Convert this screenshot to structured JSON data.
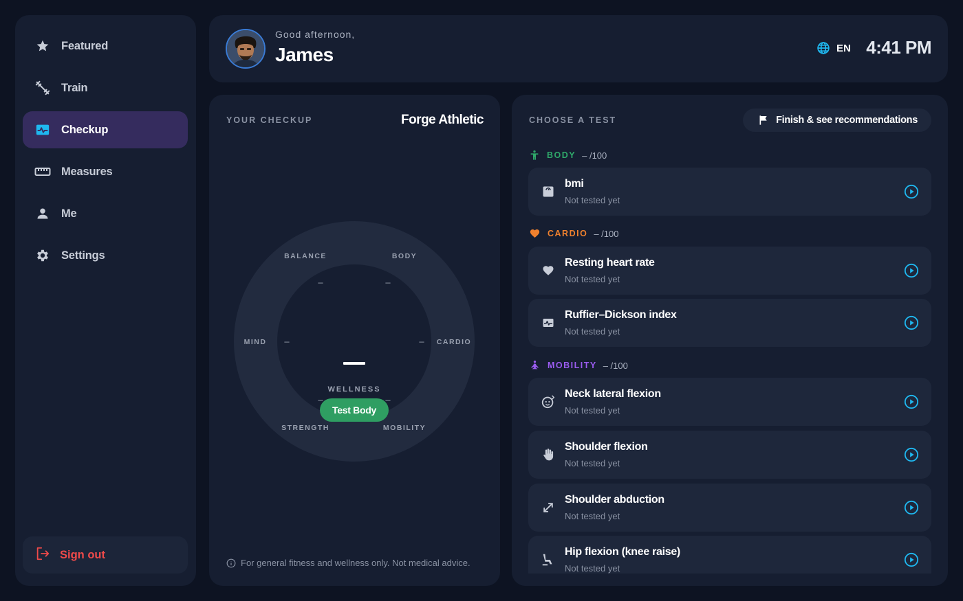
{
  "sidebar": {
    "items": [
      {
        "label": "Featured",
        "icon": "star-icon"
      },
      {
        "label": "Train",
        "icon": "dumbbell-icon"
      },
      {
        "label": "Checkup",
        "icon": "monitor-heart-icon",
        "active": true
      },
      {
        "label": "Measures",
        "icon": "ruler-icon"
      },
      {
        "label": "Me",
        "icon": "person-icon"
      },
      {
        "label": "Settings",
        "icon": "gear-icon"
      }
    ],
    "signout_label": "Sign out"
  },
  "header": {
    "greeting": "Good afternoon,",
    "name": "James",
    "language": "EN",
    "time": "4:41 PM"
  },
  "checkup": {
    "label": "YOUR CHECKUP",
    "gym": "Forge Athletic",
    "wheel": {
      "segments": {
        "balance": {
          "label": "BALANCE",
          "value": "–"
        },
        "body": {
          "label": "BODY",
          "value": "–"
        },
        "cardio": {
          "label": "CARDIO",
          "value": "–"
        },
        "mobility": {
          "label": "MOBILITY",
          "value": "–"
        },
        "strength": {
          "label": "STRENGTH",
          "value": "–"
        },
        "mind": {
          "label": "MIND",
          "value": "–"
        }
      },
      "center_label": "WELLNESS",
      "button_label": "Test Body"
    },
    "disclaimer": "For general fitness and wellness only. Not medical advice."
  },
  "tests": {
    "label": "CHOOSE A TEST",
    "finish_label": "Finish & see recommendations",
    "categories": [
      {
        "name": "BODY",
        "score": "– /100",
        "color": "#2fa86a",
        "icon": "body-icon"
      },
      {
        "name": "CARDIO",
        "score": "– /100",
        "color": "#f0812e",
        "icon": "heart-icon"
      },
      {
        "name": "MOBILITY",
        "score": "– /100",
        "color": "#9a5cf0",
        "icon": "yoga-icon"
      }
    ],
    "cards": [
      {
        "title": "bmi",
        "status": "Not tested yet",
        "icon": "scale-icon"
      },
      {
        "title": "Resting heart rate",
        "status": "Not tested yet",
        "icon": "heart-icon"
      },
      {
        "title": "Ruffier–Dickson index",
        "status": "Not tested yet",
        "icon": "monitor-heart-icon"
      },
      {
        "title": "Neck lateral flexion",
        "status": "Not tested yet",
        "icon": "face-icon"
      },
      {
        "title": "Shoulder flexion",
        "status": "Not tested yet",
        "icon": "hand-icon"
      },
      {
        "title": "Shoulder abduction",
        "status": "Not tested yet",
        "icon": "expand-arrows-icon"
      },
      {
        "title": "Hip flexion (knee raise)",
        "status": "Not tested yet",
        "icon": "seat-icon"
      }
    ]
  },
  "colors": {
    "accent": "#1fb8f0",
    "active_nav": "#352c5e",
    "danger": "#ef4a4a",
    "success": "#2f9e62"
  }
}
